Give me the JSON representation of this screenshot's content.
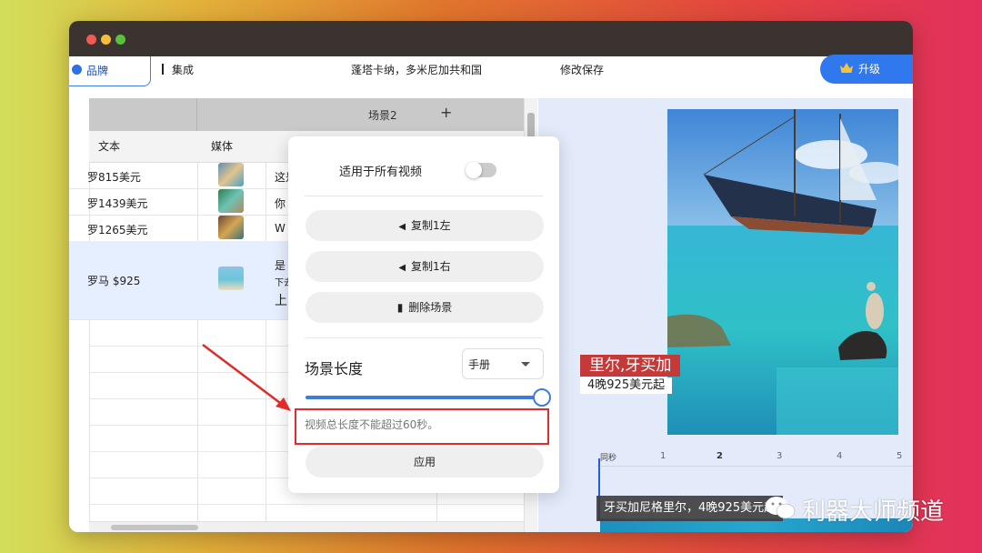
{
  "toolbar": {
    "brand_tab": "品牌",
    "integrate_tab": "集成",
    "project_title": "蓬塔卡纳，多米尼加共和国",
    "save_label": "修改保存",
    "upgrade_label": "升级"
  },
  "table": {
    "scene_label": "场景2",
    "add_icon": "+",
    "columns": [
      "文本",
      "媒体"
    ],
    "rows": [
      {
        "text": "罗815美元",
        "msg": "这是"
      },
      {
        "text": "罗1439美元",
        "msg": "你"
      },
      {
        "text": "罗1265美元",
        "msg": "W"
      },
      {
        "text": "罗马 $925",
        "msg1": "是",
        "msg2": "下去",
        "msg3": "上"
      }
    ]
  },
  "popup": {
    "apply_all_label": "适用于所有视频",
    "apply_all_on": false,
    "copy_left": "复制1左",
    "copy_right": "复制1右",
    "delete_scene": "删除场景",
    "length_label": "场景长度",
    "mode_value": "手册",
    "slider_value": 1.0,
    "warning": "视频总长度不能超过60秒。",
    "apply_button": "应用"
  },
  "preview": {
    "caption_title": "里尔,牙买加",
    "caption_sub": "4晚925美元起",
    "timeline_label": "同秒",
    "ticks": [
      "1",
      "2",
      "3",
      "4",
      "5"
    ],
    "timeline_caption": "牙买加尼格里尔，4晚925美元起"
  },
  "watermark": "利器大师频道",
  "colors": {
    "accent": "#2f78ee",
    "highlight": "#e12a2a",
    "selected_row": "#e6efff"
  }
}
